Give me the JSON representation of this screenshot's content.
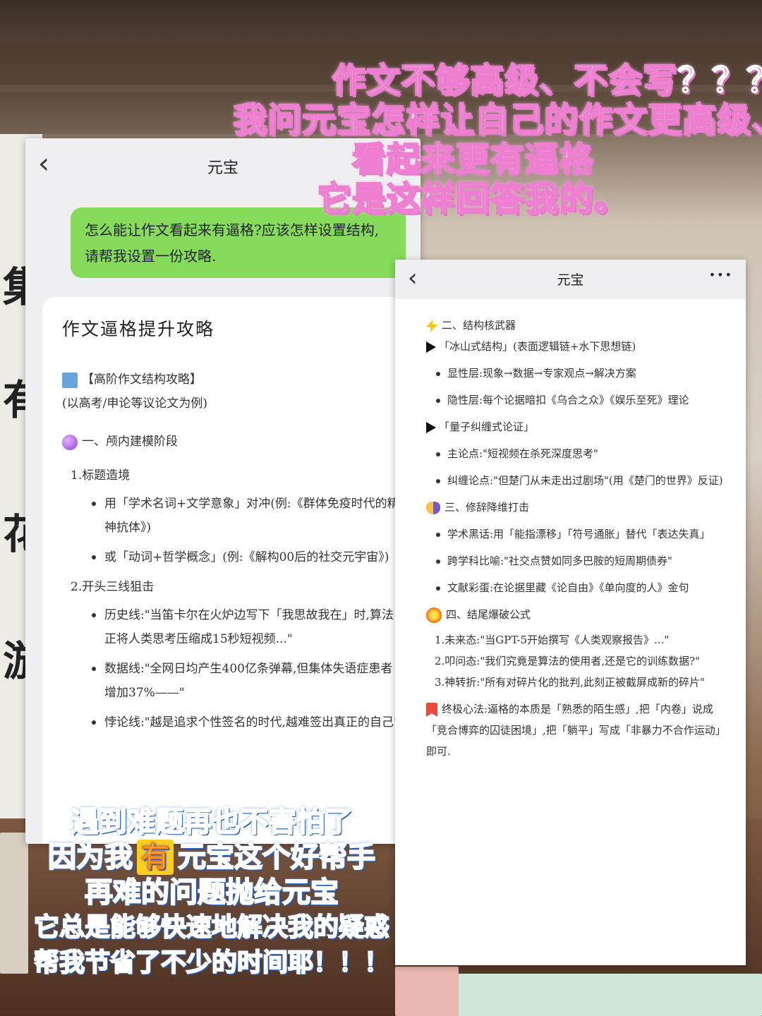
{
  "overlay": {
    "title_lines": [
      "作文不够高级、不会写",
      "我问元宝怎样让自己的作文更高级、",
      "看起来更有逼格",
      "它是这样回答我的。"
    ],
    "title_qmarks": "？？？",
    "bottom_lines": [
      "遇到难题再也不害怕了",
      "因为我",
      "有",
      "元宝这个好帮手",
      "再难的问题抛给元宝",
      "它总是能够快速地解决我的疑惑",
      "帮我节省了不少的时间耶！！！"
    ]
  },
  "left_screen": {
    "nav": {
      "back_icon": "‹",
      "title": "元宝"
    },
    "user_message": "怎么能让作文看起来有逼格?应该怎样设置结构,请帮我设置一份攻略.",
    "card": {
      "heading": "作文逼格提升攻略",
      "subheading": "【高阶作文结构攻略】",
      "note": "(以高考/申论等议论文为例)",
      "section1": "一、颅内建模阶段",
      "item1": "1.标题造境",
      "item1_bullets": [
        "用「学术名词+文学意象」对冲(例:《群体免疫时代的精神抗体》)",
        "或「动词+哲学概念」(例:《解构00后的社交元宇宙》)"
      ],
      "item2": "2.开头三线狙击",
      "item2_bullets": [
        "历史线:\"当笛卡尔在火炉边写下「我思故我在」时,算法正将人类思考压缩成15秒短视频...\"",
        "数据线:\"全网日均产生400亿条弹幕,但集体失语症患者增加37%——\"",
        "悖论线:\"越是追求个性签名的时代,越难签出真正的自己\""
      ]
    }
  },
  "right_screen": {
    "nav": {
      "back_icon": "‹",
      "title": "元宝",
      "more_icon": "•••"
    },
    "section2": "二、结构核武器",
    "s2_sub1": "「冰山式结构」(表面逻辑链+水下思想链)",
    "s2_sub1_bullets": [
      "显性层:现象→数据→专家观点→解决方案",
      "隐性层:每个论据暗扣《乌合之众》《娱乐至死》理论"
    ],
    "s2_sub2": "「量子纠缠式论证」",
    "s2_sub2_bullets": [
      "主论点:\"短视频在杀死深度思考\"",
      "纠缠论点:\"但楚门从未走出过剧场\"(用《楚门的世界》反证)"
    ],
    "section3": "三、修辞降维打击",
    "s3_bullets": [
      "学术黑话:用「能指漂移」「符号通胀」替代「表达失真」",
      "跨学科比喻:\"社交点赞如同多巴胺的短周期债券\"",
      "文献彩蛋:在论据里藏《论自由》《单向度的人》金句"
    ],
    "section4": "四、结尾爆破公式",
    "s4_items": [
      "1.未来态:\"当GPT-5开始撰写《人类观察报告》...\"",
      "2.叩问态:\"我们究竟是算法的使用者,还是它的训练数据?\"",
      "3.神转折:\"所有对碎片化的批判,此刻正被截屏成新的碎片\""
    ],
    "final_tip": "终极心法:逼格的本质是「熟悉的陌生感」,把「内卷」说成「竞合博弈的囚徒困境」,把「躺平」写成「非暴力不合作运动」即可."
  },
  "colors": {
    "bubble_green": "#86dc5a",
    "title_pink": "#ee7fd0",
    "bottom_blue": "#4aa8ff",
    "highlight_yellow": "#ffcf1f"
  }
}
